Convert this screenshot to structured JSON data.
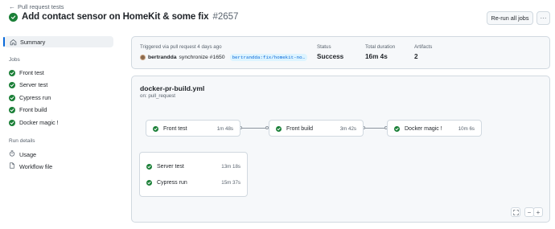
{
  "header": {
    "back_link": "Pull request tests",
    "title": "Add contact sensor on HomeKit & some fix",
    "run_number": "#2657",
    "rerun_label": "Re-run all jobs",
    "more_label": "···"
  },
  "sidebar": {
    "summary_label": "Summary",
    "jobs_heading": "Jobs",
    "jobs": [
      {
        "label": "Front test"
      },
      {
        "label": "Server test"
      },
      {
        "label": "Cypress run"
      },
      {
        "label": "Front build"
      },
      {
        "label": "Docker magic !"
      }
    ],
    "run_details_heading": "Run details",
    "details": [
      {
        "label": "Usage",
        "icon": "stopwatch-icon"
      },
      {
        "label": "Workflow file",
        "icon": "file-icon"
      }
    ]
  },
  "summary": {
    "trigger_label": "Triggered via pull request 4 days ago",
    "actor": "bertrandda",
    "action": "synchronize #1650",
    "branch": "bertrandda:fix/homekit-no…",
    "status_label": "Status",
    "status_value": "Success",
    "duration_label": "Total duration",
    "duration_value": "16m 4s",
    "artifacts_label": "Artifacts",
    "artifacts_value": "2"
  },
  "workflow": {
    "file": "docker-pr-build.yml",
    "trigger": "on: pull_request",
    "jobs": {
      "front_test": {
        "name": "Front test",
        "duration": "1m 48s"
      },
      "front_build": {
        "name": "Front build",
        "duration": "3m 42s"
      },
      "docker_magic": {
        "name": "Docker magic !",
        "duration": "10m 6s"
      },
      "server_test": {
        "name": "Server test",
        "duration": "13m 18s"
      },
      "cypress_run": {
        "name": "Cypress run",
        "duration": "15m 37s"
      }
    },
    "controls": {
      "fullscreen": "⛶",
      "zoom_out": "−",
      "zoom_in": "+"
    }
  },
  "colors": {
    "success": "#1a7f37",
    "accent": "#0969da"
  }
}
